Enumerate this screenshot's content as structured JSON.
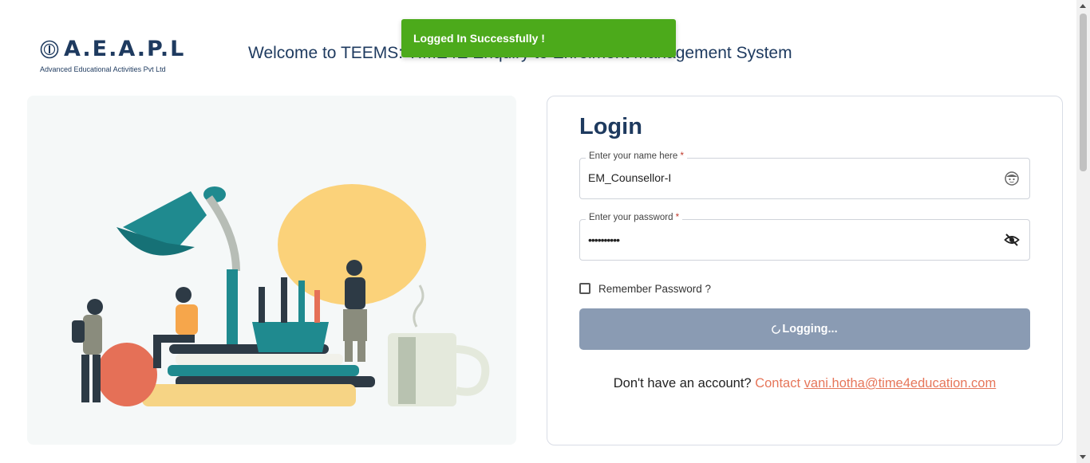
{
  "header": {
    "logo_text": "A.E.A.P.L",
    "logo_subtitle": "Advanced Educational Activities Pvt Ltd",
    "welcome_text": "Welcome to TEEMS: TIME4E Enquiry to Enrolment Management System"
  },
  "toast": {
    "message": "Logged In Successfully !",
    "color": "#4caa1b"
  },
  "login": {
    "title": "Login",
    "username": {
      "label": "Enter your name here",
      "required_mark": "*",
      "value": "EM_Counsellor-I",
      "icon": "face-icon"
    },
    "password": {
      "label": "Enter your password",
      "required_mark": "*",
      "value": "••••••••••",
      "icon": "eye-off-icon"
    },
    "remember": {
      "label": "Remember Password ?",
      "checked": false
    },
    "button": {
      "label": "Logging...",
      "icon": "spinner-icon"
    },
    "signup": {
      "text": "Don't have an account?",
      "contact_label": "Contact",
      "email": "vani.hotha@time4education.com"
    }
  },
  "colors": {
    "brand": "#1e3a5f",
    "button": "#8a9bb3",
    "link": "#e6765a",
    "lamp": "#1f8a8f",
    "sun": "#fbd27a"
  }
}
